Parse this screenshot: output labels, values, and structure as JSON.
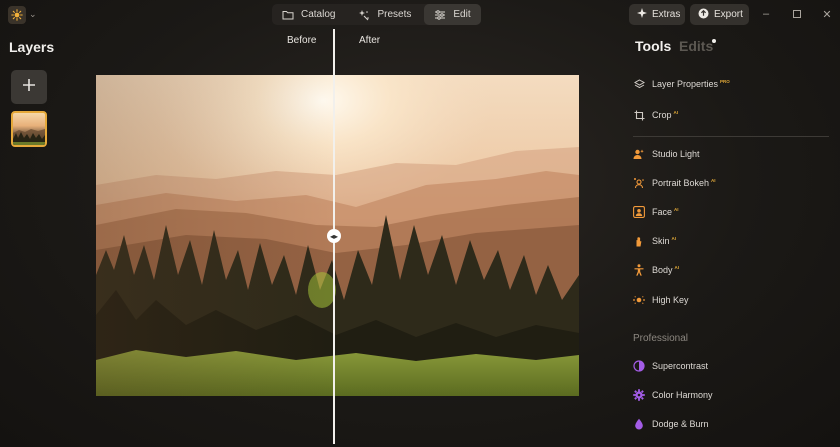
{
  "topbar": {
    "tabs": [
      {
        "label": "Catalog",
        "icon": "folder-icon"
      },
      {
        "label": "Presets",
        "icon": "sparkle-wand-icon"
      },
      {
        "label": "Edit",
        "icon": "sliders-icon",
        "active": true
      }
    ],
    "extras_label": "Extras",
    "export_label": "Export"
  },
  "layers": {
    "title": "Layers"
  },
  "canvas": {
    "before_label": "Before",
    "after_label": "After"
  },
  "tools_panel": {
    "tools_tab": "Tools",
    "edits_tab": "Edits",
    "basic_tools": [
      {
        "label": "Layer Properties",
        "badge": "PRO",
        "icon": "layers-icon"
      },
      {
        "label": "Crop",
        "badge": "AI",
        "icon": "crop-icon"
      }
    ],
    "portrait_tools": [
      {
        "label": "Studio Light",
        "badge": "",
        "icon": "studio-light-icon"
      },
      {
        "label": "Portrait Bokeh",
        "badge": "AI",
        "icon": "portrait-bokeh-icon"
      },
      {
        "label": "Face",
        "badge": "AI",
        "icon": "face-icon"
      },
      {
        "label": "Skin",
        "badge": "AI",
        "icon": "skin-hand-icon"
      },
      {
        "label": "Body",
        "badge": "AI",
        "icon": "body-icon"
      },
      {
        "label": "High Key",
        "badge": "",
        "icon": "high-key-icon"
      }
    ],
    "professional_section": "Professional",
    "professional_tools": [
      {
        "label": "Supercontrast",
        "badge": "",
        "icon": "supercontrast-icon"
      },
      {
        "label": "Color Harmony",
        "badge": "",
        "icon": "color-harmony-gear-icon"
      },
      {
        "label": "Dodge & Burn",
        "badge": "",
        "icon": "dodge-burn-drop-icon"
      }
    ]
  },
  "colors": {
    "accent_orange": "#f29a3a",
    "accent_purple": "#a35ce6",
    "pro_badge": "#e0a838"
  }
}
